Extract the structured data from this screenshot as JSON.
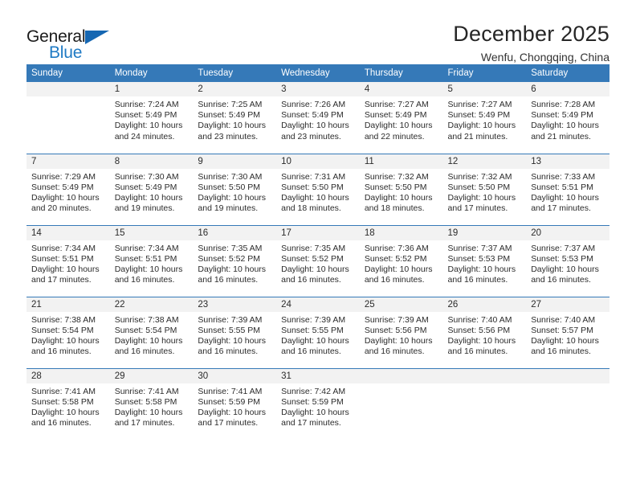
{
  "brand": {
    "name_part1": "General",
    "name_part2": "Blue",
    "accent_color": "#1f7ac4",
    "triangle_color": "#1667b2"
  },
  "header": {
    "title": "December 2025",
    "subtitle": "Wenfu, Chongqing, China"
  },
  "calendar": {
    "header_bg": "#3579b8",
    "daynum_bg": "#f2f2f2",
    "weekday_headers": [
      "Sunday",
      "Monday",
      "Tuesday",
      "Wednesday",
      "Thursday",
      "Friday",
      "Saturday"
    ],
    "weeks": [
      [
        {
          "day": "",
          "sunrise": "",
          "sunset": "",
          "daylight_line1": "",
          "daylight_line2": ""
        },
        {
          "day": "1",
          "sunrise": "Sunrise: 7:24 AM",
          "sunset": "Sunset: 5:49 PM",
          "daylight_line1": "Daylight: 10 hours",
          "daylight_line2": "and 24 minutes."
        },
        {
          "day": "2",
          "sunrise": "Sunrise: 7:25 AM",
          "sunset": "Sunset: 5:49 PM",
          "daylight_line1": "Daylight: 10 hours",
          "daylight_line2": "and 23 minutes."
        },
        {
          "day": "3",
          "sunrise": "Sunrise: 7:26 AM",
          "sunset": "Sunset: 5:49 PM",
          "daylight_line1": "Daylight: 10 hours",
          "daylight_line2": "and 23 minutes."
        },
        {
          "day": "4",
          "sunrise": "Sunrise: 7:27 AM",
          "sunset": "Sunset: 5:49 PM",
          "daylight_line1": "Daylight: 10 hours",
          "daylight_line2": "and 22 minutes."
        },
        {
          "day": "5",
          "sunrise": "Sunrise: 7:27 AM",
          "sunset": "Sunset: 5:49 PM",
          "daylight_line1": "Daylight: 10 hours",
          "daylight_line2": "and 21 minutes."
        },
        {
          "day": "6",
          "sunrise": "Sunrise: 7:28 AM",
          "sunset": "Sunset: 5:49 PM",
          "daylight_line1": "Daylight: 10 hours",
          "daylight_line2": "and 21 minutes."
        }
      ],
      [
        {
          "day": "7",
          "sunrise": "Sunrise: 7:29 AM",
          "sunset": "Sunset: 5:49 PM",
          "daylight_line1": "Daylight: 10 hours",
          "daylight_line2": "and 20 minutes."
        },
        {
          "day": "8",
          "sunrise": "Sunrise: 7:30 AM",
          "sunset": "Sunset: 5:49 PM",
          "daylight_line1": "Daylight: 10 hours",
          "daylight_line2": "and 19 minutes."
        },
        {
          "day": "9",
          "sunrise": "Sunrise: 7:30 AM",
          "sunset": "Sunset: 5:50 PM",
          "daylight_line1": "Daylight: 10 hours",
          "daylight_line2": "and 19 minutes."
        },
        {
          "day": "10",
          "sunrise": "Sunrise: 7:31 AM",
          "sunset": "Sunset: 5:50 PM",
          "daylight_line1": "Daylight: 10 hours",
          "daylight_line2": "and 18 minutes."
        },
        {
          "day": "11",
          "sunrise": "Sunrise: 7:32 AM",
          "sunset": "Sunset: 5:50 PM",
          "daylight_line1": "Daylight: 10 hours",
          "daylight_line2": "and 18 minutes."
        },
        {
          "day": "12",
          "sunrise": "Sunrise: 7:32 AM",
          "sunset": "Sunset: 5:50 PM",
          "daylight_line1": "Daylight: 10 hours",
          "daylight_line2": "and 17 minutes."
        },
        {
          "day": "13",
          "sunrise": "Sunrise: 7:33 AM",
          "sunset": "Sunset: 5:51 PM",
          "daylight_line1": "Daylight: 10 hours",
          "daylight_line2": "and 17 minutes."
        }
      ],
      [
        {
          "day": "14",
          "sunrise": "Sunrise: 7:34 AM",
          "sunset": "Sunset: 5:51 PM",
          "daylight_line1": "Daylight: 10 hours",
          "daylight_line2": "and 17 minutes."
        },
        {
          "day": "15",
          "sunrise": "Sunrise: 7:34 AM",
          "sunset": "Sunset: 5:51 PM",
          "daylight_line1": "Daylight: 10 hours",
          "daylight_line2": "and 16 minutes."
        },
        {
          "day": "16",
          "sunrise": "Sunrise: 7:35 AM",
          "sunset": "Sunset: 5:52 PM",
          "daylight_line1": "Daylight: 10 hours",
          "daylight_line2": "and 16 minutes."
        },
        {
          "day": "17",
          "sunrise": "Sunrise: 7:35 AM",
          "sunset": "Sunset: 5:52 PM",
          "daylight_line1": "Daylight: 10 hours",
          "daylight_line2": "and 16 minutes."
        },
        {
          "day": "18",
          "sunrise": "Sunrise: 7:36 AM",
          "sunset": "Sunset: 5:52 PM",
          "daylight_line1": "Daylight: 10 hours",
          "daylight_line2": "and 16 minutes."
        },
        {
          "day": "19",
          "sunrise": "Sunrise: 7:37 AM",
          "sunset": "Sunset: 5:53 PM",
          "daylight_line1": "Daylight: 10 hours",
          "daylight_line2": "and 16 minutes."
        },
        {
          "day": "20",
          "sunrise": "Sunrise: 7:37 AM",
          "sunset": "Sunset: 5:53 PM",
          "daylight_line1": "Daylight: 10 hours",
          "daylight_line2": "and 16 minutes."
        }
      ],
      [
        {
          "day": "21",
          "sunrise": "Sunrise: 7:38 AM",
          "sunset": "Sunset: 5:54 PM",
          "daylight_line1": "Daylight: 10 hours",
          "daylight_line2": "and 16 minutes."
        },
        {
          "day": "22",
          "sunrise": "Sunrise: 7:38 AM",
          "sunset": "Sunset: 5:54 PM",
          "daylight_line1": "Daylight: 10 hours",
          "daylight_line2": "and 16 minutes."
        },
        {
          "day": "23",
          "sunrise": "Sunrise: 7:39 AM",
          "sunset": "Sunset: 5:55 PM",
          "daylight_line1": "Daylight: 10 hours",
          "daylight_line2": "and 16 minutes."
        },
        {
          "day": "24",
          "sunrise": "Sunrise: 7:39 AM",
          "sunset": "Sunset: 5:55 PM",
          "daylight_line1": "Daylight: 10 hours",
          "daylight_line2": "and 16 minutes."
        },
        {
          "day": "25",
          "sunrise": "Sunrise: 7:39 AM",
          "sunset": "Sunset: 5:56 PM",
          "daylight_line1": "Daylight: 10 hours",
          "daylight_line2": "and 16 minutes."
        },
        {
          "day": "26",
          "sunrise": "Sunrise: 7:40 AM",
          "sunset": "Sunset: 5:56 PM",
          "daylight_line1": "Daylight: 10 hours",
          "daylight_line2": "and 16 minutes."
        },
        {
          "day": "27",
          "sunrise": "Sunrise: 7:40 AM",
          "sunset": "Sunset: 5:57 PM",
          "daylight_line1": "Daylight: 10 hours",
          "daylight_line2": "and 16 minutes."
        }
      ],
      [
        {
          "day": "28",
          "sunrise": "Sunrise: 7:41 AM",
          "sunset": "Sunset: 5:58 PM",
          "daylight_line1": "Daylight: 10 hours",
          "daylight_line2": "and 16 minutes."
        },
        {
          "day": "29",
          "sunrise": "Sunrise: 7:41 AM",
          "sunset": "Sunset: 5:58 PM",
          "daylight_line1": "Daylight: 10 hours",
          "daylight_line2": "and 17 minutes."
        },
        {
          "day": "30",
          "sunrise": "Sunrise: 7:41 AM",
          "sunset": "Sunset: 5:59 PM",
          "daylight_line1": "Daylight: 10 hours",
          "daylight_line2": "and 17 minutes."
        },
        {
          "day": "31",
          "sunrise": "Sunrise: 7:42 AM",
          "sunset": "Sunset: 5:59 PM",
          "daylight_line1": "Daylight: 10 hours",
          "daylight_line2": "and 17 minutes."
        },
        {
          "day": "",
          "sunrise": "",
          "sunset": "",
          "daylight_line1": "",
          "daylight_line2": ""
        },
        {
          "day": "",
          "sunrise": "",
          "sunset": "",
          "daylight_line1": "",
          "daylight_line2": ""
        },
        {
          "day": "",
          "sunrise": "",
          "sunset": "",
          "daylight_line1": "",
          "daylight_line2": ""
        }
      ]
    ]
  }
}
